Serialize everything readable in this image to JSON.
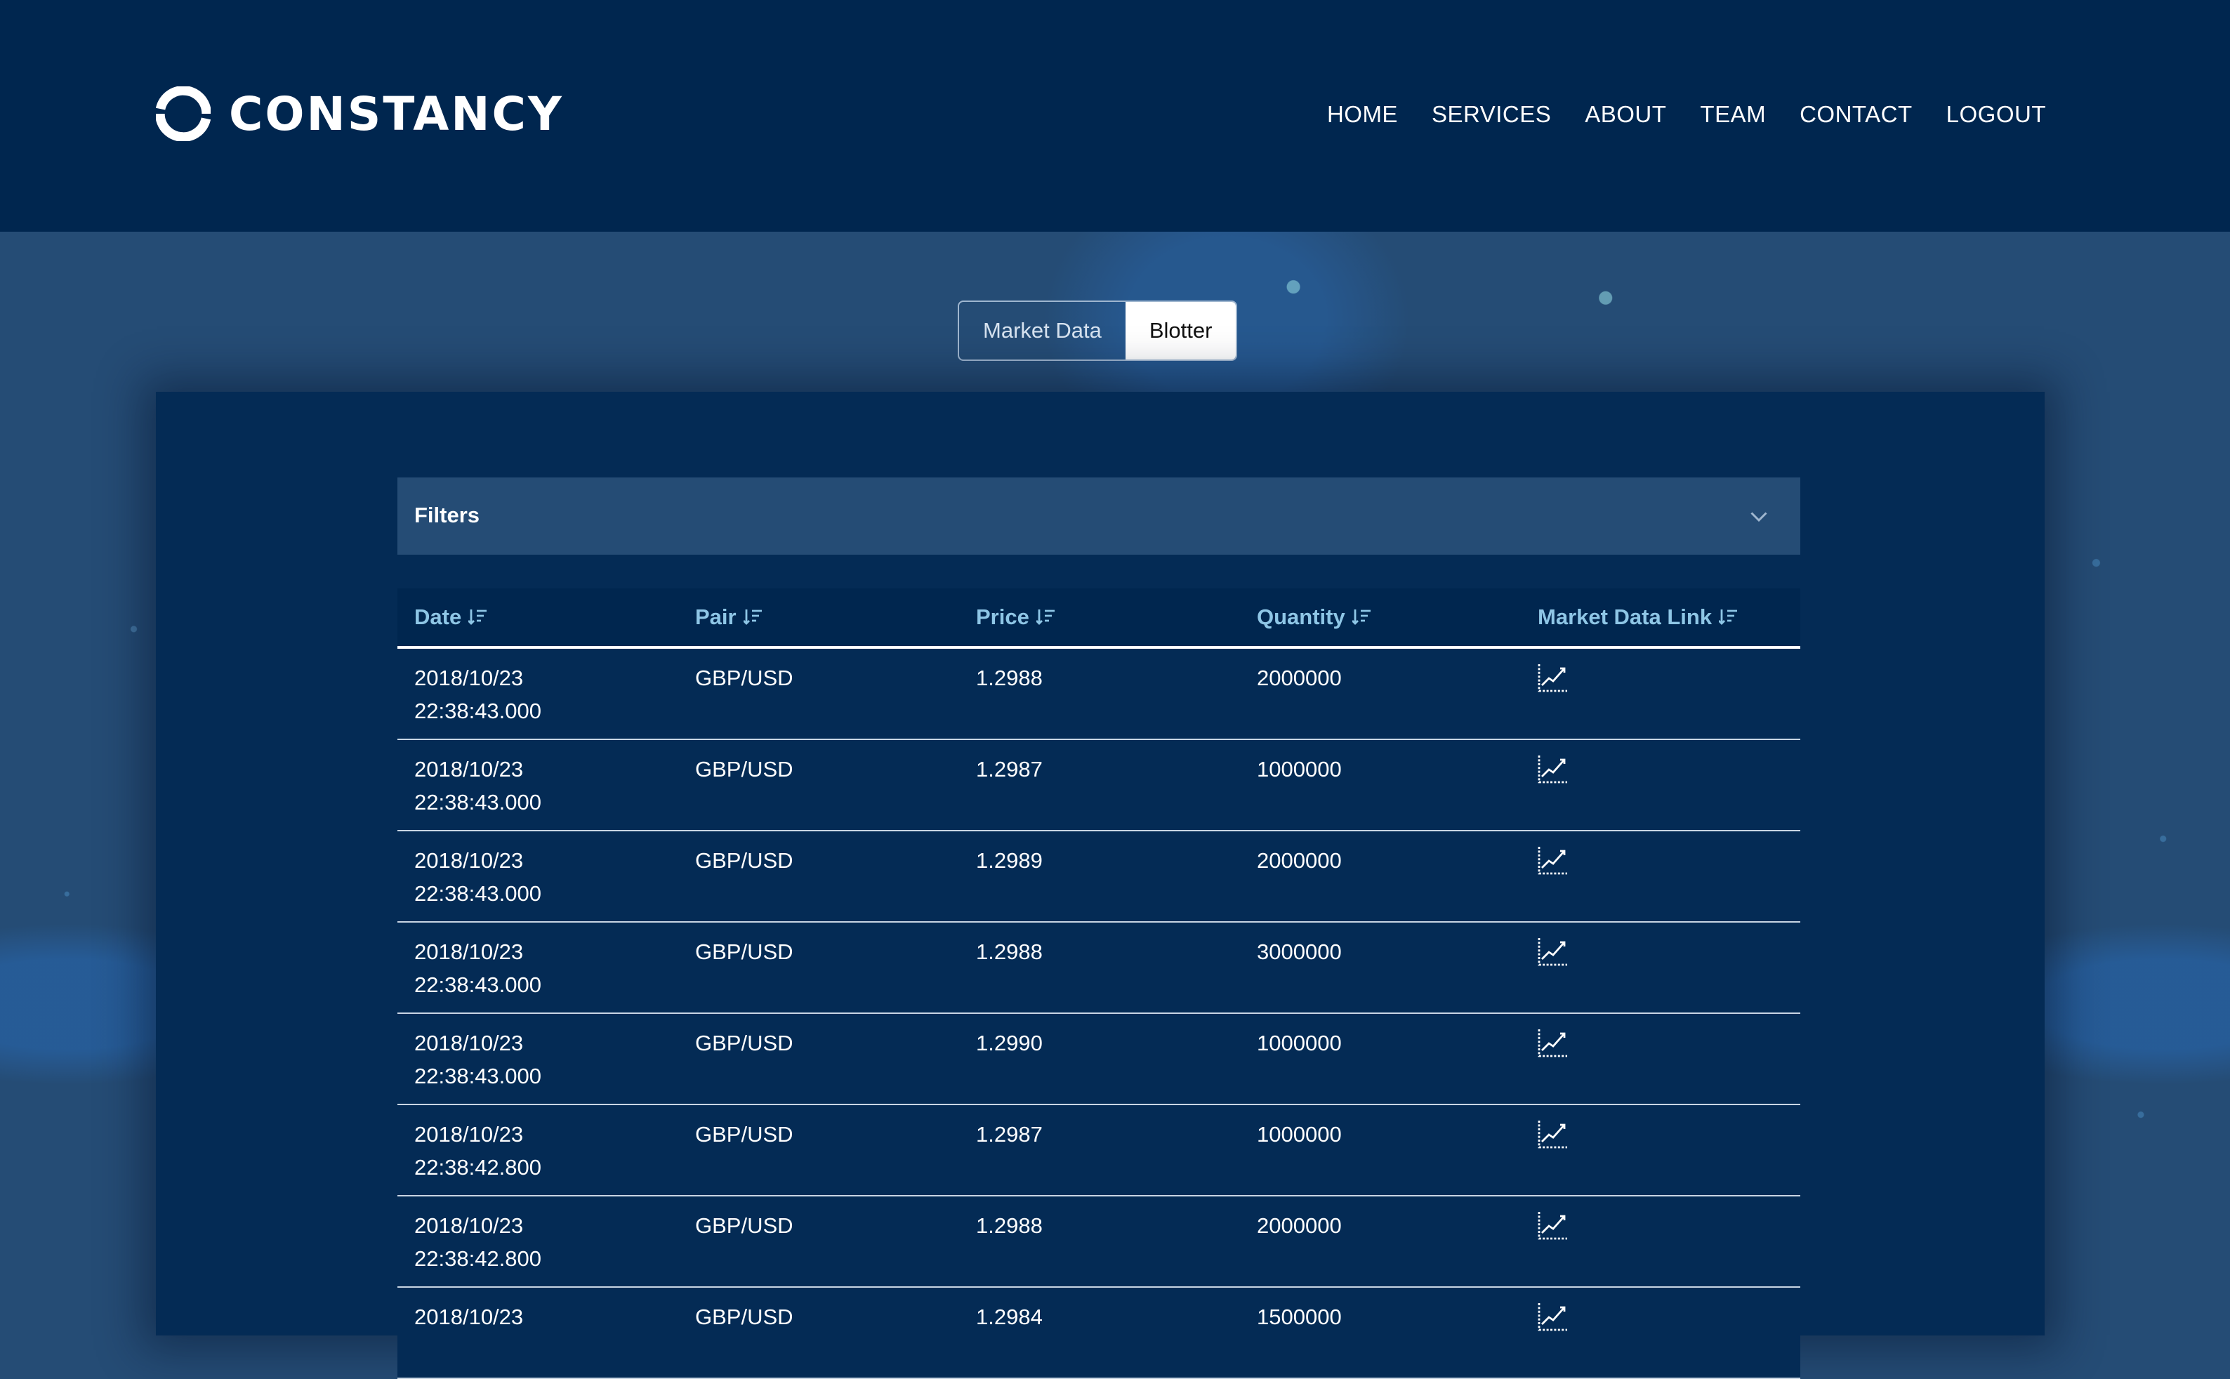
{
  "brand": {
    "name": "CONSTANCY",
    "logo_icon": "constancy-logo-icon"
  },
  "nav": {
    "items": [
      "HOME",
      "SERVICES",
      "ABOUT",
      "TEAM",
      "CONTACT",
      "LOGOUT"
    ]
  },
  "view_toggle": {
    "options": [
      "Market Data",
      "Blotter"
    ],
    "selected": "Blotter"
  },
  "filters": {
    "label": "Filters",
    "icon": "chevron-down-icon"
  },
  "table": {
    "columns": [
      "Date",
      "Pair",
      "Price",
      "Quantity",
      "Market Data Link"
    ],
    "sort_icon": "sort-icon",
    "link_icon": "chart-line-icon",
    "rows": [
      {
        "date": "2018/10/23",
        "time": "22:38:43.000",
        "pair": "GBP/USD",
        "price": "1.2988",
        "quantity": "2000000"
      },
      {
        "date": "2018/10/23",
        "time": "22:38:43.000",
        "pair": "GBP/USD",
        "price": "1.2987",
        "quantity": "1000000"
      },
      {
        "date": "2018/10/23",
        "time": "22:38:43.000",
        "pair": "GBP/USD",
        "price": "1.2989",
        "quantity": "2000000"
      },
      {
        "date": "2018/10/23",
        "time": "22:38:43.000",
        "pair": "GBP/USD",
        "price": "1.2988",
        "quantity": "3000000"
      },
      {
        "date": "2018/10/23",
        "time": "22:38:43.000",
        "pair": "GBP/USD",
        "price": "1.2990",
        "quantity": "1000000"
      },
      {
        "date": "2018/10/23",
        "time": "22:38:42.800",
        "pair": "GBP/USD",
        "price": "1.2987",
        "quantity": "1000000"
      },
      {
        "date": "2018/10/23",
        "time": "22:38:42.800",
        "pair": "GBP/USD",
        "price": "1.2988",
        "quantity": "2000000"
      },
      {
        "date": "2018/10/23",
        "time": "",
        "pair": "GBP/USD",
        "price": "1.2984",
        "quantity": "1500000"
      }
    ]
  },
  "colors": {
    "header_bg": "#00264f",
    "panel_bg": "#042b55",
    "filters_bg": "#254c75",
    "column_header_text": "#8ec6e6"
  }
}
